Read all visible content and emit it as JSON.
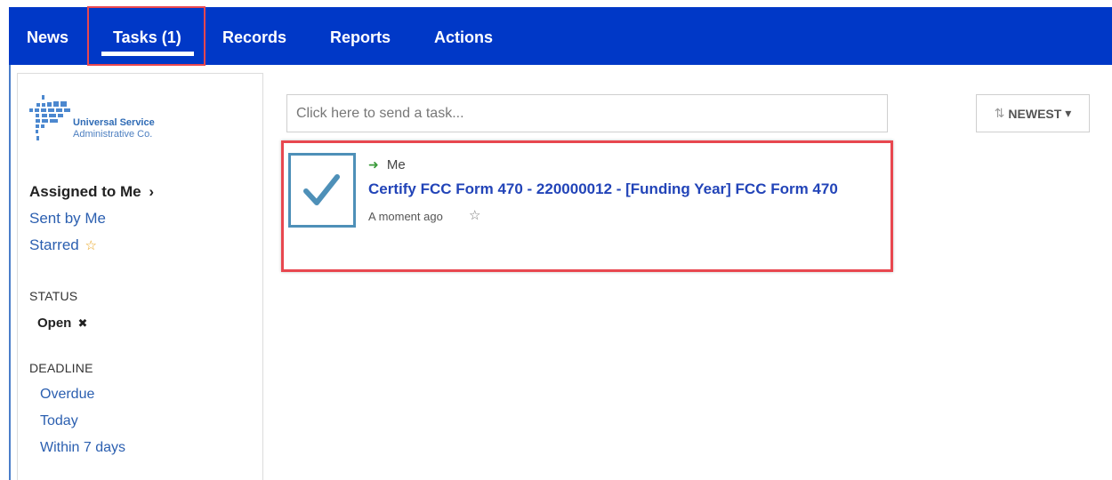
{
  "nav": {
    "items": [
      {
        "label": "News"
      },
      {
        "label": "Tasks (1)"
      },
      {
        "label": "Records"
      },
      {
        "label": "Reports"
      },
      {
        "label": "Actions"
      }
    ],
    "active": "Tasks (1)"
  },
  "logo": {
    "line1": "Universal Service",
    "line2": "Administrative Co."
  },
  "sidebar": {
    "filters": {
      "assigned": "Assigned to Me",
      "assigned_chevron": "›",
      "sent": "Sent by Me",
      "starred": "Starred",
      "starred_icon": "☆"
    },
    "status": {
      "heading": "STATUS",
      "value": "Open",
      "remove": "✖"
    },
    "deadline": {
      "heading": "DEADLINE",
      "options": [
        "Overdue",
        "Today",
        "Within 7 days"
      ]
    }
  },
  "search": {
    "placeholder": "Click here to send a task..."
  },
  "sort": {
    "label": "NEWEST",
    "icon": "⇅",
    "caret": "▾"
  },
  "task": {
    "assignee_arrow": "➜",
    "assignee": "Me",
    "title": "Certify FCC Form 470 - 220000012 - [Funding Year] FCC Form 470",
    "time": "A moment ago",
    "star": "☆",
    "checked": true
  },
  "colors": {
    "navbar": "#0038c7",
    "highlight": "#e8474f",
    "link": "#2b5fb0",
    "task_title": "#2244b8",
    "checkbox": "#4e90b8"
  }
}
